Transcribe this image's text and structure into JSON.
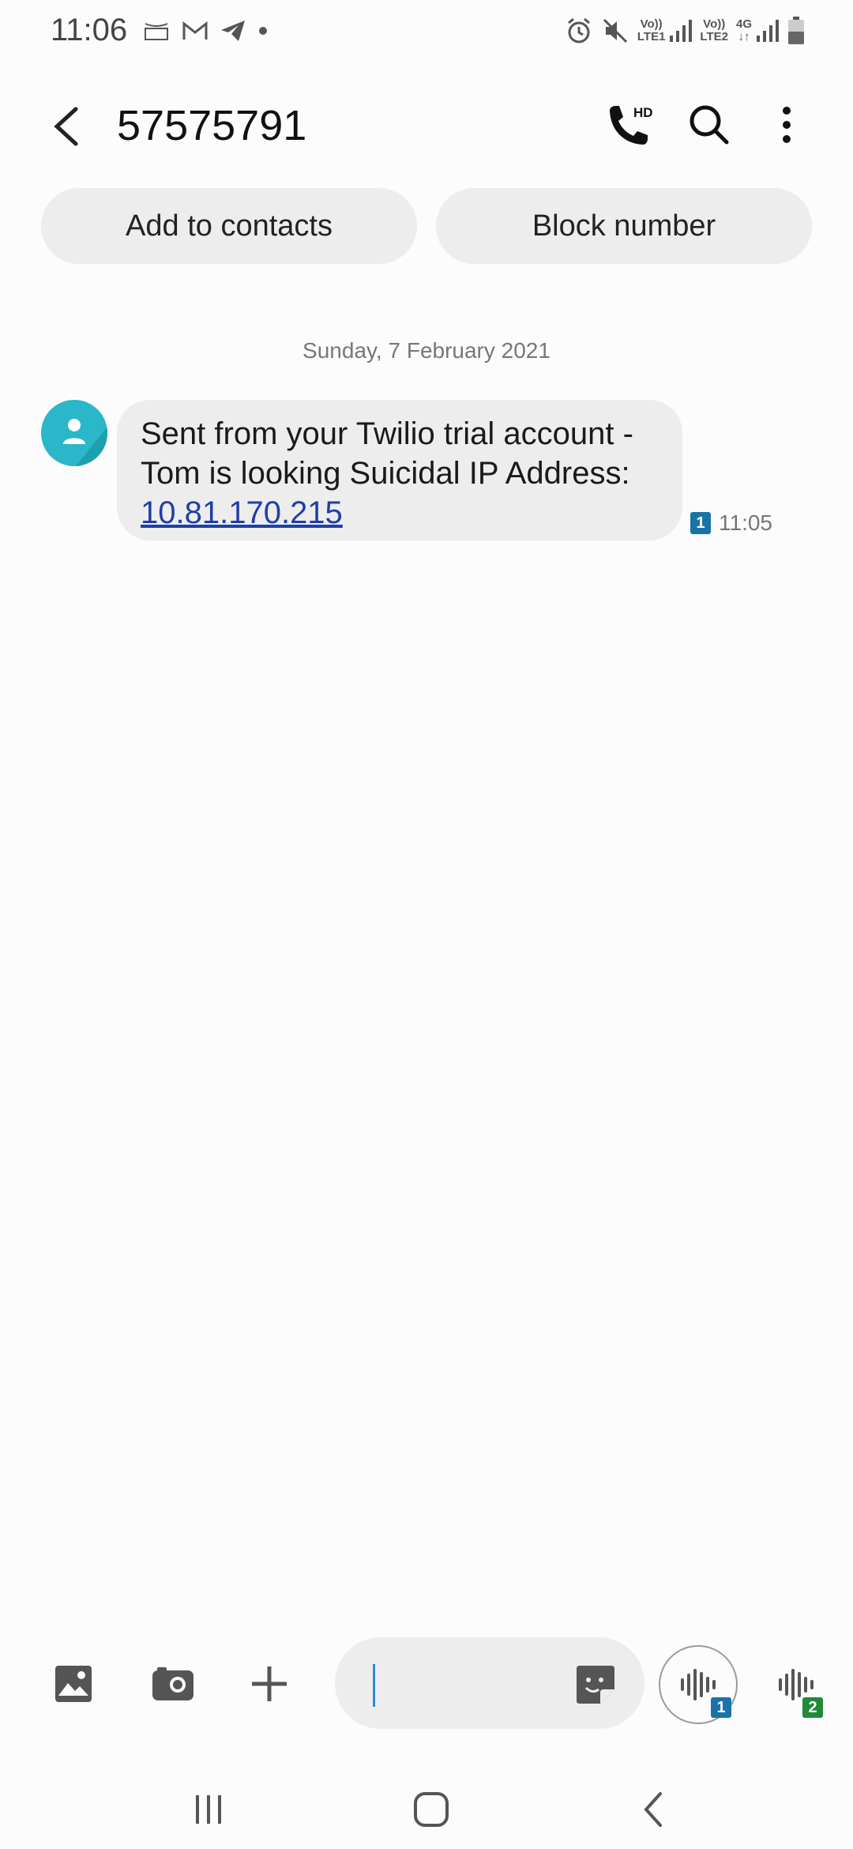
{
  "status_bar": {
    "time": "11:06",
    "left_icons": [
      "amazon-icon",
      "gmail-icon",
      "telegram-icon",
      "dot-icon"
    ],
    "right_icons": [
      "alarm-icon",
      "mute-icon",
      "volte1-signal-icon",
      "volte2-signal-icon",
      "4g-icon",
      "battery-icon"
    ],
    "sim1_label_top": "Vo))",
    "sim1_label_bottom": "LTE1",
    "sim2_label_top": "Vo))",
    "sim2_label_bottom": "LTE2",
    "network_label": "4G"
  },
  "header": {
    "title": "57575791",
    "call_badge": "HD"
  },
  "actions": {
    "add_contact": "Add to contacts",
    "block_number": "Block number"
  },
  "conversation": {
    "date": "Sunday, 7 February 2021",
    "messages": [
      {
        "text_before": "Sent from your Twilio trial account - Tom is looking Suicidal IP Address: ",
        "link": "10.81.170.215",
        "sim": "1",
        "time": "11:05"
      }
    ]
  },
  "composer": {
    "placeholder": "",
    "voice_sim1": "1",
    "voice_sim2": "2"
  },
  "colors": {
    "avatar": "#2ab7c9",
    "link": "#1f3fa8",
    "sim1": "#1a73a8",
    "sim2": "#1f8a3a",
    "caret": "#2a8fd6"
  }
}
